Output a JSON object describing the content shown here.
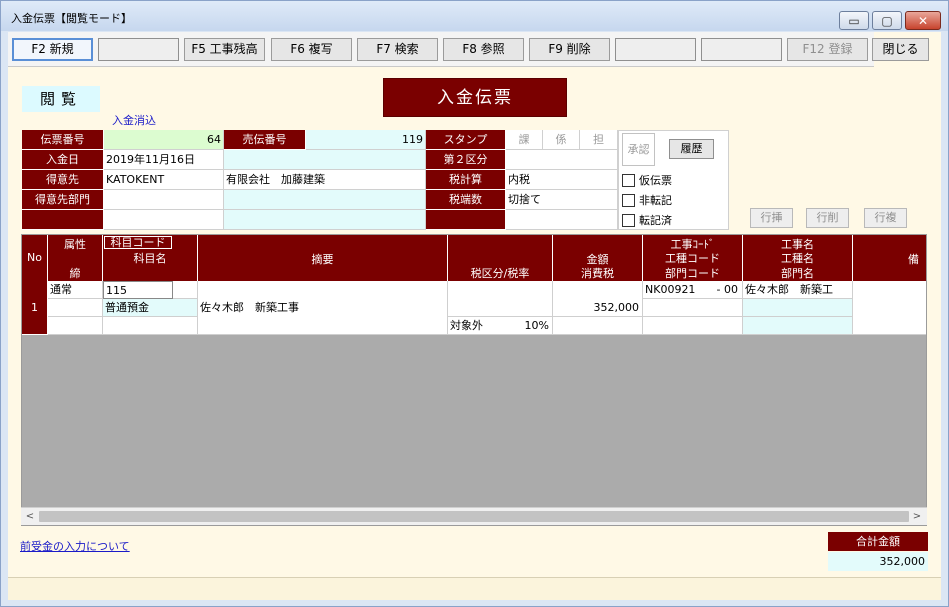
{
  "window": {
    "title": "入金伝票【閲覧モード】",
    "min_glyph": "▭",
    "max_glyph": "▢",
    "close_glyph": "✕"
  },
  "toolbar": {
    "buttons": [
      {
        "label": "F2 新規",
        "state": "active"
      },
      {
        "label": "",
        "state": "blank"
      },
      {
        "label": "F5 工事残高",
        "state": "normal"
      },
      {
        "label": "F6 複写",
        "state": "normal"
      },
      {
        "label": "F7 検索",
        "state": "normal"
      },
      {
        "label": "F8 参照",
        "state": "normal"
      },
      {
        "label": "F9 削除",
        "state": "normal"
      },
      {
        "label": "",
        "state": "blank"
      },
      {
        "label": "",
        "state": "blank"
      },
      {
        "label": "F12 登録",
        "state": "disabled"
      }
    ],
    "close_label": "閉じる"
  },
  "mode_label": "閲覧",
  "banner_title": "入金伝票",
  "kesikomi_label": "入金消込",
  "header": {
    "slip_no_label": "伝票番号",
    "slip_no": "64",
    "sales_no_label": "売伝番号",
    "sales_no": "119",
    "stamp_label": "スタンプ",
    "stamp_cells": [
      "課",
      "係",
      "担"
    ],
    "date_label": "入金日",
    "date": "2019年11月16日",
    "second_class_label": "第２区分",
    "customer_label": "得意先",
    "customer_code": "KATOKENT",
    "customer_name": "有限会社　加藤建築",
    "tax_calc_label": "税計算",
    "tax_calc": "内税",
    "customer_dept_label": "得意先部門",
    "rounding_label": "税端数",
    "rounding": "切捨て",
    "approval_label": "承認",
    "history_label": "履歴",
    "checks": [
      "仮伝票",
      "非転記",
      "転記済"
    ]
  },
  "row_buttons": [
    "行挿",
    "行削",
    "行複"
  ],
  "grid": {
    "headers": {
      "no": "No",
      "attr": "属性",
      "shime": "締",
      "account_code": "科目コード",
      "account_name": "科目名",
      "summary": "摘要",
      "tax": "税区分/税率",
      "amount": "金額",
      "consumption_tax": "消費税",
      "job_code": "工事ｺｰﾄﾞ",
      "work_code": "工種コード",
      "dept_code": "部門コード",
      "job_name": "工事名",
      "work_name": "工種名",
      "dept_name": "部門名",
      "remarks": "備"
    },
    "rows": [
      {
        "no": "1",
        "attr": "通常",
        "account_code": "115",
        "account_name": "普通預金",
        "summary": "佐々木郎　新築工事",
        "tax_class": "対象外",
        "tax_rate": "10%",
        "amount": "352,000",
        "job_code": "NK00921",
        "job_sub": "- 00",
        "job_name": "佐々木郎　新築工"
      }
    ]
  },
  "link_text": "前受金の入力について",
  "total": {
    "label": "合計金額",
    "value": "352,000"
  },
  "colors": {
    "label_bg": "#7a0000",
    "value_tint": "#e3fbfb",
    "form_bg": "#fff9e6"
  }
}
